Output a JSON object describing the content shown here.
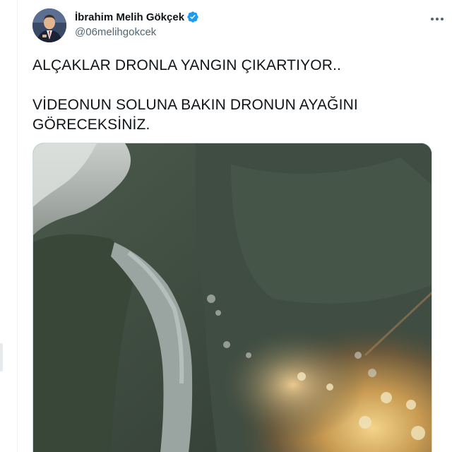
{
  "tweet": {
    "author": {
      "display_name": "İbrahim Melih Gökçek",
      "handle": "@06melihgokcek",
      "verified": true,
      "avatar_icon": "profile-photo"
    },
    "menu_icon": "more-dots-icon",
    "text_lines": [
      "ALÇAKLAR DRONLA YANGIN ÇIKARTIYOR..",
      "VİDEONUN SOLUNA BAKIN DRONUN AYAĞINI",
      "GÖRECEKSİNİZ."
    ],
    "media": {
      "type": "video",
      "subject": "aerial view of forest fire along a road"
    }
  },
  "colors": {
    "text": "#0f1419",
    "secondary_text": "#536471",
    "verified_blue": "#1d9bf0",
    "border": "#cfd9de"
  }
}
